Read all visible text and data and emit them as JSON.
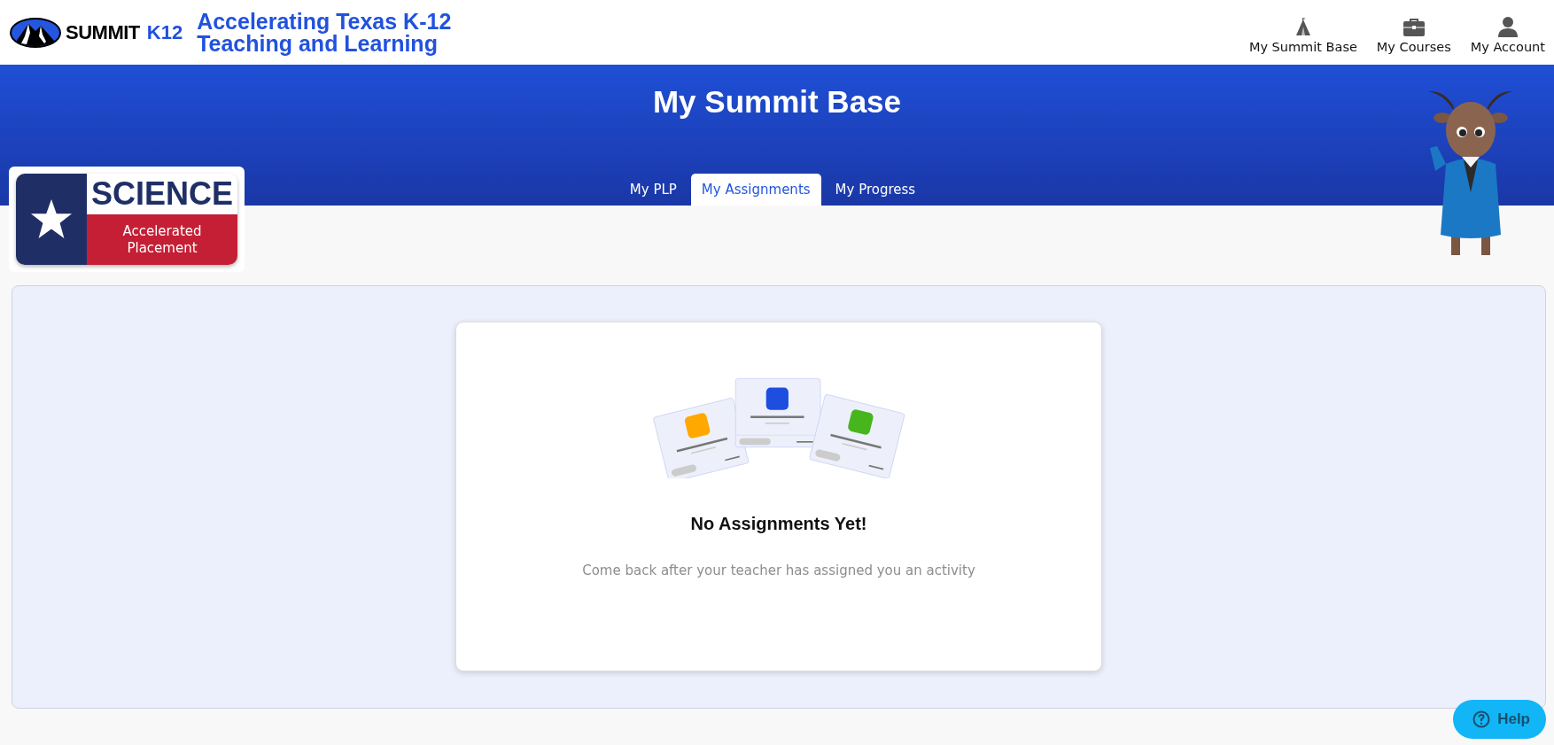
{
  "header": {
    "brand": {
      "name": "SUMMIT",
      "accent": "K12"
    },
    "tagline_lines": [
      "Accelerating Texas K-12",
      "Teaching and Learning"
    ],
    "nav": [
      {
        "label": "My Summit Base",
        "kind": "tent"
      },
      {
        "label": "My Courses",
        "kind": "briefcase"
      },
      {
        "label": "My Account",
        "kind": "person"
      }
    ]
  },
  "banner": {
    "title": "My Summit Base",
    "tabs": [
      {
        "label": "My PLP",
        "selected": false
      },
      {
        "label": "My Assignments",
        "selected": true
      },
      {
        "label": "My Progress",
        "selected": false
      }
    ]
  },
  "badge": {
    "subject": "SCIENCE",
    "caption": "Accelerated Placement"
  },
  "empty_state": {
    "title": "No Assignments Yet!",
    "message": "Come back after your teacher has assigned you an activity"
  },
  "help_button": {
    "label": "Help"
  }
}
